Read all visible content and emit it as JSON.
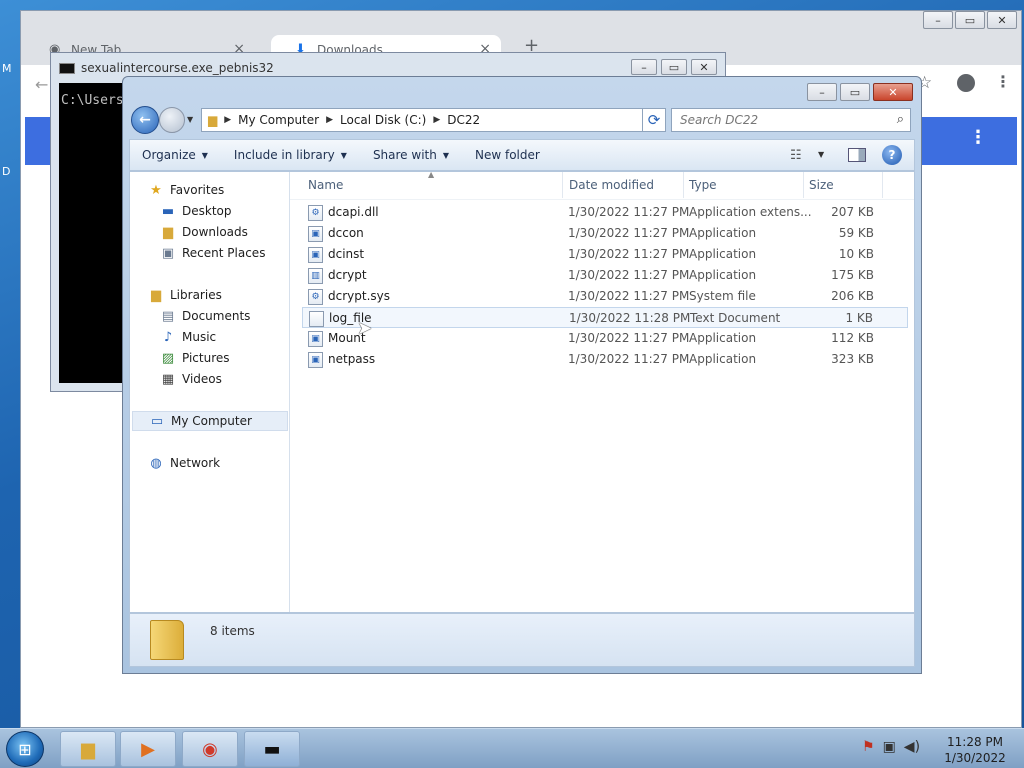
{
  "desktop": {
    "edge_letters": [
      "M",
      "D"
    ]
  },
  "chrome": {
    "tabs": [
      {
        "label": "New Tab",
        "icon": "chrome-icon"
      },
      {
        "label": "Downloads",
        "icon": "download-icon"
      }
    ],
    "new_tab": "+"
  },
  "console": {
    "title": "sexualintercourse.exe_pebnis32",
    "text": "C:\\Users"
  },
  "explorer": {
    "breadcrumbs": [
      "My Computer",
      "Local Disk (C:)",
      "DC22"
    ],
    "search_placeholder": "Search DC22",
    "toolbar": {
      "organize": "Organize",
      "include": "Include in library",
      "share": "Share with",
      "new_folder": "New folder"
    },
    "nav": {
      "favorites": "Favorites",
      "desktop": "Desktop",
      "downloads": "Downloads",
      "recent": "Recent Places",
      "libraries": "Libraries",
      "documents": "Documents",
      "music": "Music",
      "pictures": "Pictures",
      "videos": "Videos",
      "computer": "My Computer",
      "network": "Network"
    },
    "columns": {
      "name": "Name",
      "date": "Date modified",
      "type": "Type",
      "size": "Size"
    },
    "files": [
      {
        "name": "dcapi.dll",
        "date": "1/30/2022 11:27 PM",
        "type": "Application extens...",
        "size": "207 KB"
      },
      {
        "name": "dccon",
        "date": "1/30/2022 11:27 PM",
        "type": "Application",
        "size": "59 KB"
      },
      {
        "name": "dcinst",
        "date": "1/30/2022 11:27 PM",
        "type": "Application",
        "size": "10 KB"
      },
      {
        "name": "dcrypt",
        "date": "1/30/2022 11:27 PM",
        "type": "Application",
        "size": "175 KB"
      },
      {
        "name": "dcrypt.sys",
        "date": "1/30/2022 11:27 PM",
        "type": "System file",
        "size": "206 KB"
      },
      {
        "name": "log_file",
        "date": "1/30/2022 11:28 PM",
        "type": "Text Document",
        "size": "1 KB"
      },
      {
        "name": "Mount",
        "date": "1/30/2022 11:27 PM",
        "type": "Application",
        "size": "112 KB"
      },
      {
        "name": "netpass",
        "date": "1/30/2022 11:27 PM",
        "type": "Application",
        "size": "323 KB"
      }
    ],
    "item_count": "8 items"
  },
  "taskbar": {
    "time": "11:28 PM",
    "date": "1/30/2022"
  }
}
